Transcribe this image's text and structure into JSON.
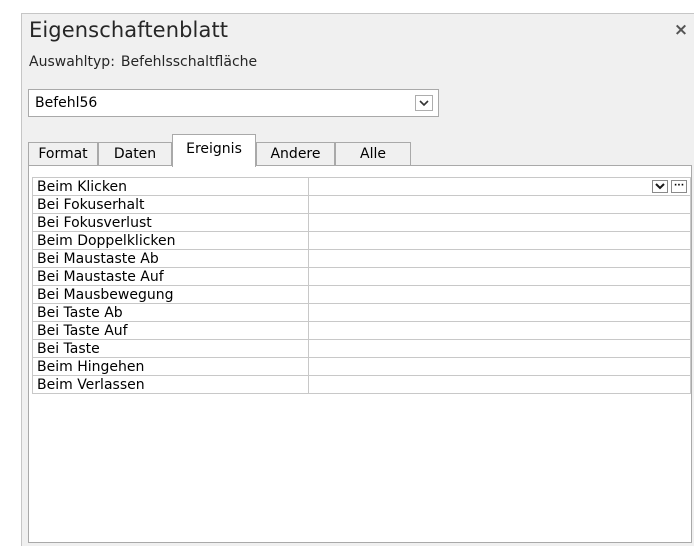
{
  "panel": {
    "title": "Eigenschaftenblatt",
    "close_glyph": "×",
    "selection_type_label": "Auswahltyp:",
    "selection_type_value": "Befehlsschaltfläche"
  },
  "object_selector": {
    "value": "Befehl56"
  },
  "tabs": [
    {
      "label": "Format",
      "active": false
    },
    {
      "label": "Daten",
      "active": false
    },
    {
      "label": "Ereignis",
      "active": true
    },
    {
      "label": "Andere",
      "active": false
    },
    {
      "label": "Alle",
      "active": false
    }
  ],
  "properties": [
    {
      "name": "Beim Klicken",
      "value": ""
    },
    {
      "name": "Bei Fokuserhalt",
      "value": ""
    },
    {
      "name": "Bei Fokusverlust",
      "value": ""
    },
    {
      "name": "Beim Doppelklicken",
      "value": ""
    },
    {
      "name": "Bei Maustaste Ab",
      "value": ""
    },
    {
      "name": "Bei Maustaste Auf",
      "value": ""
    },
    {
      "name": "Bei Mausbewegung",
      "value": ""
    },
    {
      "name": "Bei Taste Ab",
      "value": ""
    },
    {
      "name": "Bei Taste Auf",
      "value": ""
    },
    {
      "name": "Bei Taste",
      "value": ""
    },
    {
      "name": "Beim Hingehen",
      "value": ""
    },
    {
      "name": "Beim Verlassen",
      "value": ""
    }
  ],
  "row_buttons": {
    "builder_glyph": "···"
  },
  "icons": {
    "close": "close-icon",
    "dropdown": "chevron-down-icon",
    "builder": "ellipsis-icon"
  },
  "colors": {
    "panel_bg": "#f0f0f0",
    "grid_border": "#c8c8c8",
    "title_text": "#262626"
  }
}
